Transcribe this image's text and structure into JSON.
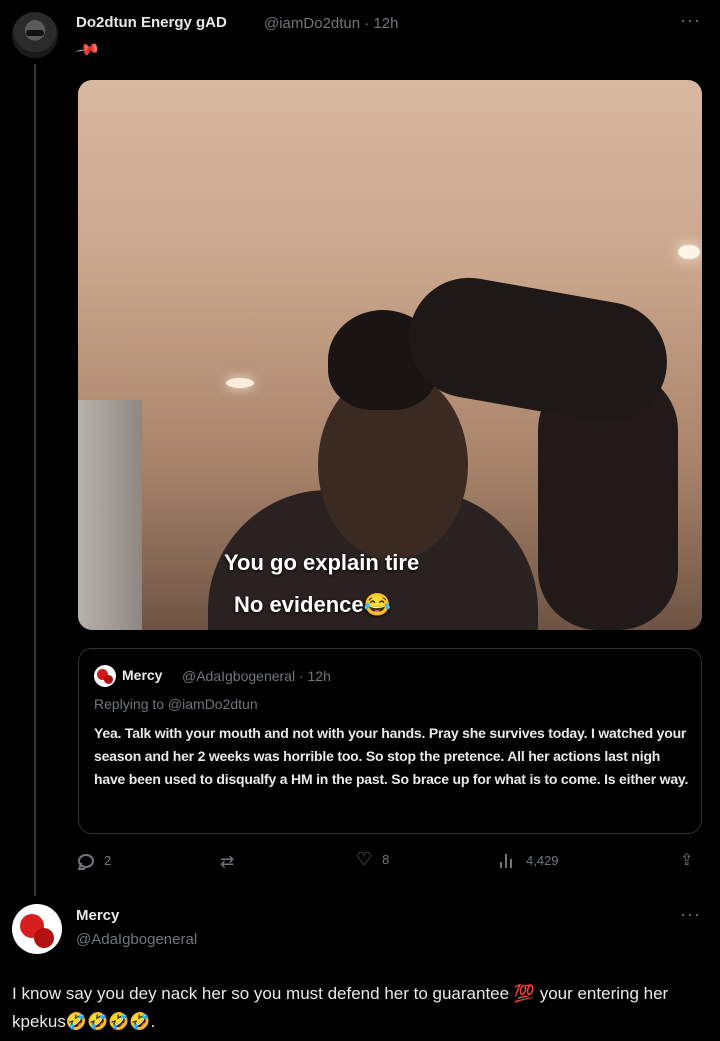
{
  "tweet1": {
    "author_name": "Do2dtun Energy gAD",
    "handle_time": "@iamDo2dtun · 12h",
    "more": "···",
    "pin_icon": "pin-icon",
    "media_caption_line1": "You go explain tire",
    "media_caption_line2": "No evidence😂",
    "quote": {
      "author_name": "Mercy",
      "handle_time": "@AdaIgbogeneral · 12h",
      "replying_to": "Replying to @iamDo2dtun",
      "text": "Yea. Talk with your mouth and not with your hands. Pray she survives today. I watched your season and her 2 weeks was horrible too. So stop the pretence. All her actions last nigh have been used to disqualfy a HM in the past. So brace up for what is to come. Is either way."
    },
    "actions": {
      "replies": "2",
      "retweets": "",
      "likes": "8",
      "views": "4,429"
    }
  },
  "tweet2": {
    "author_name": "Mercy",
    "handle": "@AdaIgbogeneral",
    "more": "···",
    "text": "I know say you dey nack her so you must defend her to guarantee 💯 your entering her kpekus🤣🤣🤣🤣."
  },
  "colors": {
    "background": "#000000",
    "text": "#e7e9ea",
    "muted": "#71767b",
    "border": "#2f3336",
    "pin": "#f91880"
  }
}
